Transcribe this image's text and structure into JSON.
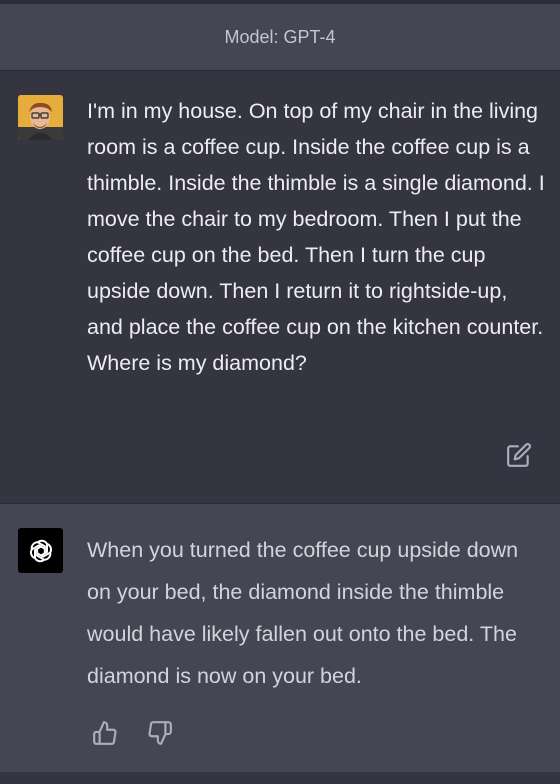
{
  "header": {
    "model_label": "Model: GPT-4"
  },
  "user_message": {
    "avatar_icon": "user-avatar-photo",
    "text": "I'm in my house. On top of my chair in the living room is a coffee cup. Inside the coffee cup is a thimble. Inside the thimble is a single diamond. I move the chair to my bedroom. Then I put the coffee cup on the bed. Then I turn the cup upside down. Then I return it to rightside-up, and place the coffee cup on the kitchen counter. Where is my diamond?",
    "edit_icon": "edit-icon"
  },
  "assistant_message": {
    "avatar_icon": "openai-logo-icon",
    "text": "When you turned the coffee cup upside down on your bed, the diamond inside the thimble would have likely fallen out onto the bed. The diamond is now on your bed.",
    "feedback_icons": [
      "thumbs-up-icon",
      "thumbs-down-icon"
    ]
  },
  "colors": {
    "page_bg": "#343541",
    "assistant_bg": "#444654",
    "text": "#ececf1",
    "muted_text": "#c5c5d2",
    "icon": "#acacbe"
  }
}
